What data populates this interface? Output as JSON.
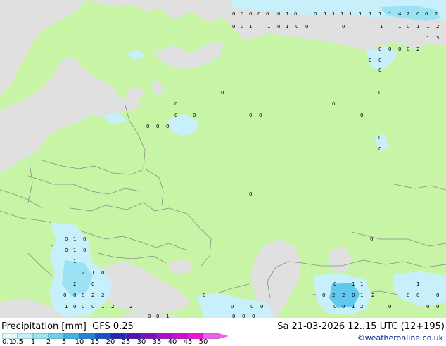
{
  "legend": {
    "title": "Precipitation [mm]",
    "model": "GFS 0.25",
    "datetime": "Sa 21-03-2026 12..15 UTC (12+195)",
    "credit": "©weatheronline.co.uk",
    "scale": [
      {
        "label": "0.1",
        "color": "#e6fbff"
      },
      {
        "label": "0.5",
        "color": "#c3f2fb"
      },
      {
        "label": "1",
        "color": "#96e6f5"
      },
      {
        "label": "2",
        "color": "#6ad0ef"
      },
      {
        "label": "5",
        "color": "#3fb2e8"
      },
      {
        "label": "10",
        "color": "#1c86dc"
      },
      {
        "label": "15",
        "color": "#1452c8"
      },
      {
        "label": "20",
        "color": "#1e2ab4"
      },
      {
        "label": "25",
        "color": "#4818b0"
      },
      {
        "label": "30",
        "color": "#7a10c0"
      },
      {
        "label": "35",
        "color": "#a80ccc"
      },
      {
        "label": "40",
        "color": "#d00ad4"
      },
      {
        "label": "45",
        "color": "#ee10dc"
      },
      {
        "label": "50",
        "color": "#f060f0"
      }
    ]
  },
  "map": {
    "land_color": "#c7f5a5",
    "sea_color": "#e0e0e0",
    "border_color": "#8a8a8a",
    "rain_light_color": "#c8f0fa",
    "rain_color": "#9ae2f4",
    "rain_mid_color": "#5ec8ee",
    "values": [
      [
        "0",
        "0",
        "0",
        "0",
        "0",
        "0",
        "1",
        "0"
      ],
      [
        "0",
        "1",
        "1",
        "1",
        "1",
        "1",
        "1",
        "1",
        "1",
        "4",
        "2",
        "0",
        "0",
        "2"
      ],
      [
        "0",
        "0",
        "1",
        "1",
        "0",
        "1",
        "0",
        "0",
        "0",
        "1",
        "1",
        "0",
        "1",
        "1",
        "2"
      ],
      [
        "1",
        "3"
      ],
      [
        "0",
        "0",
        "0",
        "0",
        "2"
      ],
      [
        "0",
        "0",
        "0"
      ],
      [
        "0",
        "0",
        "0",
        "0",
        "0",
        "0",
        "0",
        "0",
        "0",
        "0",
        "0",
        "0",
        "0"
      ],
      [
        "0",
        "0",
        "0"
      ],
      [
        "0",
        "1",
        "0",
        "0",
        "1",
        "0",
        "1",
        "2",
        "1",
        "0",
        "1",
        "2",
        "0",
        "0",
        "0",
        "8",
        "2",
        "2",
        "1",
        "0",
        "0",
        "0",
        "1",
        "2",
        "2",
        "0",
        "0",
        "0",
        "0",
        "0",
        "0",
        "1",
        "0",
        "0",
        "0"
      ],
      [
        "0",
        "1",
        "1",
        "1",
        "0",
        "2",
        "2",
        "0",
        "1",
        "0",
        "0",
        "0",
        "0",
        "1",
        "2",
        "2",
        "0",
        "0",
        "0",
        "0"
      ]
    ]
  }
}
